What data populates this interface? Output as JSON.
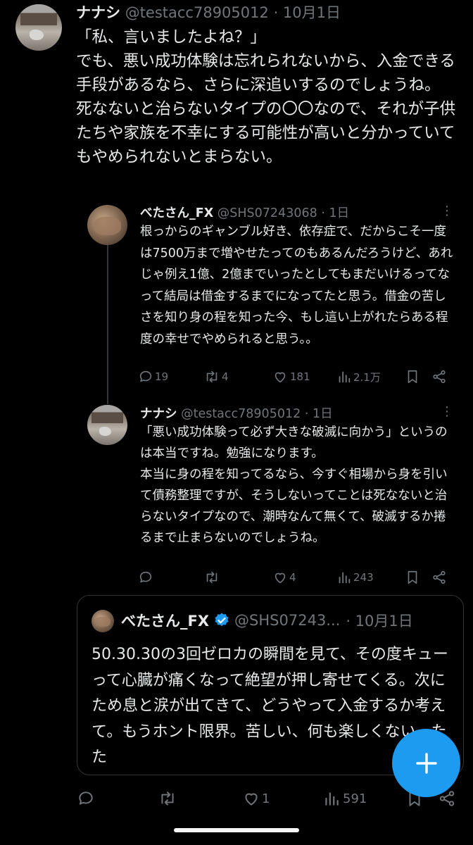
{
  "main_tweet": {
    "name": "ナナシ",
    "handle": "@testacc78905012",
    "date": "· 10月1日",
    "text": "「私、言いましたよね？」\nでも、悪い成功体験は忘れられないから、入金できる手段があるなら、さらに深追いするのでしょうね。\n死なないと治らないタイプの〇〇なので、それが子供たちや家族を不幸にする可能性が高いと分かっていてもやめられないとまらない。"
  },
  "reply1": {
    "name": "べたさん_FX",
    "handle": "@SHS07243068",
    "date": "· 1日",
    "more": "⋮",
    "text": "根っからのギャンブル好き、依存症で、だからこそ一度は7500万まで増やせたってのもあるんだろうけど、あれじゃ例え1億、2億までいったとしてもまだいけるってなって結局は借金するまでになってたと思う。借金の苦しさを知り身の程を知った今、もし這い上がれたらある程度の幸せでやめられると思う。。",
    "replies": "19",
    "retweets": "4",
    "likes": "181",
    "views": "2.1万"
  },
  "reply2": {
    "name": "ナナシ",
    "handle": "@testacc78905012",
    "date": "· 1日",
    "more": "⋮",
    "text": "「悪い成功体験って必ず大きな破滅に向かう」というのは本当ですね。勉強になります。\n本当に身の程を知ってるなら、今すぐ相場から身を引いて債務整理ですが、そうしないってことは死なないと治らないタイプなので、潮時なんて無くて、破滅するか捲るまで止まらないのでしょうね。",
    "replies": "",
    "retweets": "",
    "likes": "4",
    "views": "243"
  },
  "quote": {
    "name": "べたさん_FX",
    "handle": "@SHS07243...",
    "date": "· 10月1日",
    "text": "50.30.30の3回ゼロカの瞬間を見て、その度キューって心臓が痛くなって絶望が押し寄せてくる。次にため息と涙が出てきて、どうやって入金するか考えて。もうホント限界。苦しい、何も楽しくない。たた"
  },
  "main_actions": {
    "replies": "",
    "retweets": "",
    "likes": "1",
    "views": "591"
  },
  "colors": {
    "background": "#000000",
    "text": "#e7e9ea",
    "muted": "#71767b",
    "accent": "#1d9bf0"
  },
  "icons": [
    "more-icon",
    "reply-icon",
    "retweet-icon",
    "like-icon",
    "views-icon",
    "bookmark-icon",
    "share-icon",
    "verified-icon",
    "compose-plus-icon"
  ]
}
